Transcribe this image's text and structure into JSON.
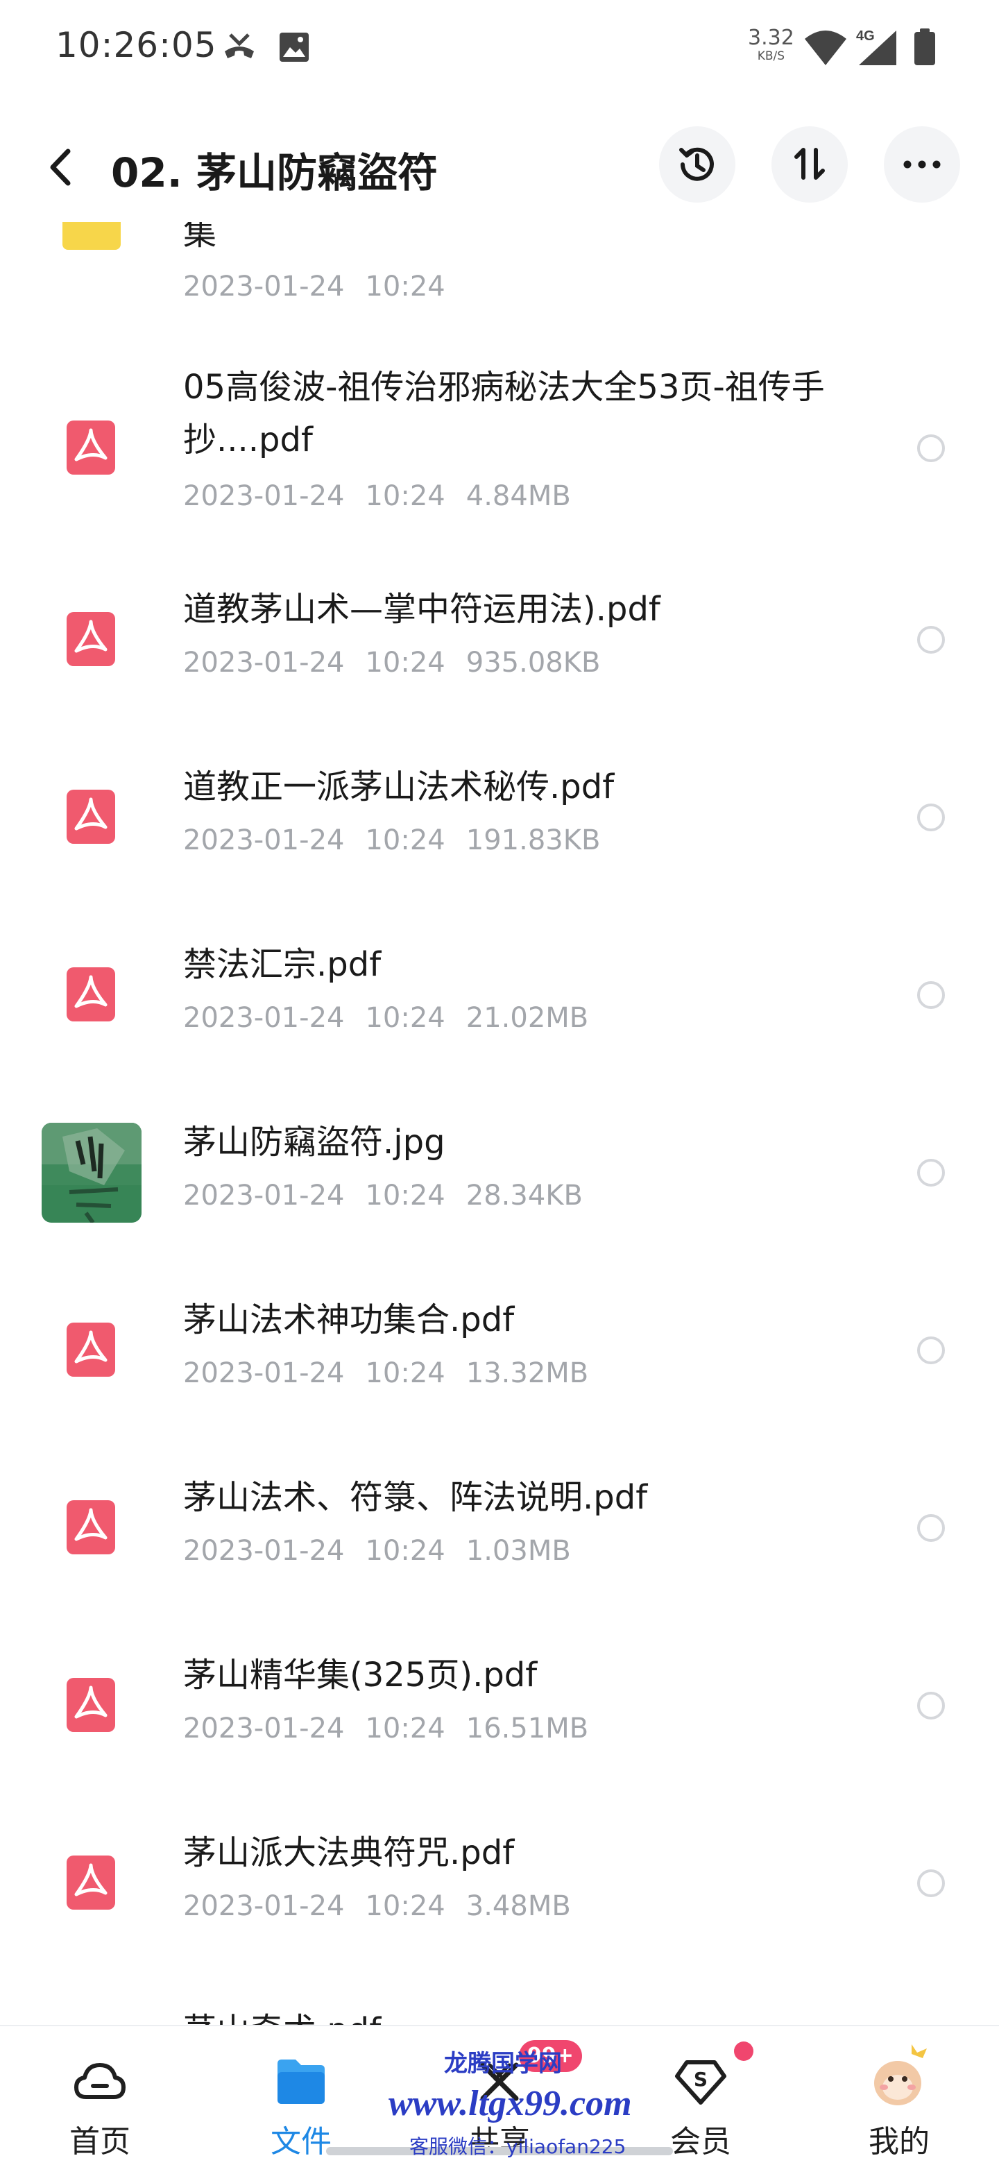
{
  "status_bar": {
    "time": "10:26:05",
    "net_speed_value": "3.32",
    "net_speed_unit": "KB/S",
    "network_label": "4G",
    "icons": [
      "missed-call-icon",
      "image-icon",
      "wifi-icon",
      "signal-icon",
      "battery-icon"
    ]
  },
  "header": {
    "title": "02. 茅山防竊盜符",
    "icons": [
      "back-icon",
      "history-icon",
      "sort-icon",
      "more-icon"
    ]
  },
  "files": [
    {
      "name": "集",
      "date": "2023-01-24",
      "time": "10:24",
      "size": "",
      "type": "folder"
    },
    {
      "name": "05高俊波-祖传治邪病秘法大全53页-祖传手抄....pdf",
      "date": "2023-01-24",
      "time": "10:24",
      "size": "4.84MB",
      "type": "pdf"
    },
    {
      "name": "道教茅山术—掌中符运用法).pdf",
      "date": "2023-01-24",
      "time": "10:24",
      "size": "935.08KB",
      "type": "pdf"
    },
    {
      "name": "道教正一派茅山法术秘传.pdf",
      "date": "2023-01-24",
      "time": "10:24",
      "size": "191.83KB",
      "type": "pdf"
    },
    {
      "name": "禁法汇宗.pdf",
      "date": "2023-01-24",
      "time": "10:24",
      "size": "21.02MB",
      "type": "pdf"
    },
    {
      "name": "茅山防竊盜符.jpg",
      "date": "2023-01-24",
      "time": "10:24",
      "size": "28.34KB",
      "type": "image"
    },
    {
      "name": "茅山法术神功集合.pdf",
      "date": "2023-01-24",
      "time": "10:24",
      "size": "13.32MB",
      "type": "pdf"
    },
    {
      "name": "茅山法术、符箓、阵法说明.pdf",
      "date": "2023-01-24",
      "time": "10:24",
      "size": "1.03MB",
      "type": "pdf"
    },
    {
      "name": "茅山精华集(325页).pdf",
      "date": "2023-01-24",
      "time": "10:24",
      "size": "16.51MB",
      "type": "pdf"
    },
    {
      "name": "茅山派大法典符咒.pdf",
      "date": "2023-01-24",
      "time": "10:24",
      "size": "3.48MB",
      "type": "pdf"
    },
    {
      "name": "茅山奇术.pdf",
      "date": "",
      "time": "",
      "size": "",
      "type": "pdf"
    }
  ],
  "tabs": [
    {
      "label": "首页",
      "icon": "cloud-home-icon"
    },
    {
      "label": "文件",
      "icon": "folder-icon",
      "active": true
    },
    {
      "label": "共享",
      "icon": "share-icon",
      "badge": "99+"
    },
    {
      "label": "会员",
      "icon": "vip-icon",
      "dot": true
    },
    {
      "label": "我的",
      "icon": "avatar-icon"
    }
  ],
  "watermark": {
    "line1": "龙腾国学网",
    "line2": "www.ltgx99.com",
    "line3": "客服微信：yiliaofan225"
  },
  "colors": {
    "accent": "#1e88e5",
    "pdf_icon": "#f05a6e",
    "folder_icon": "#f7d64a",
    "badge": "#f0466e",
    "meta_text": "#a3a6ab"
  }
}
